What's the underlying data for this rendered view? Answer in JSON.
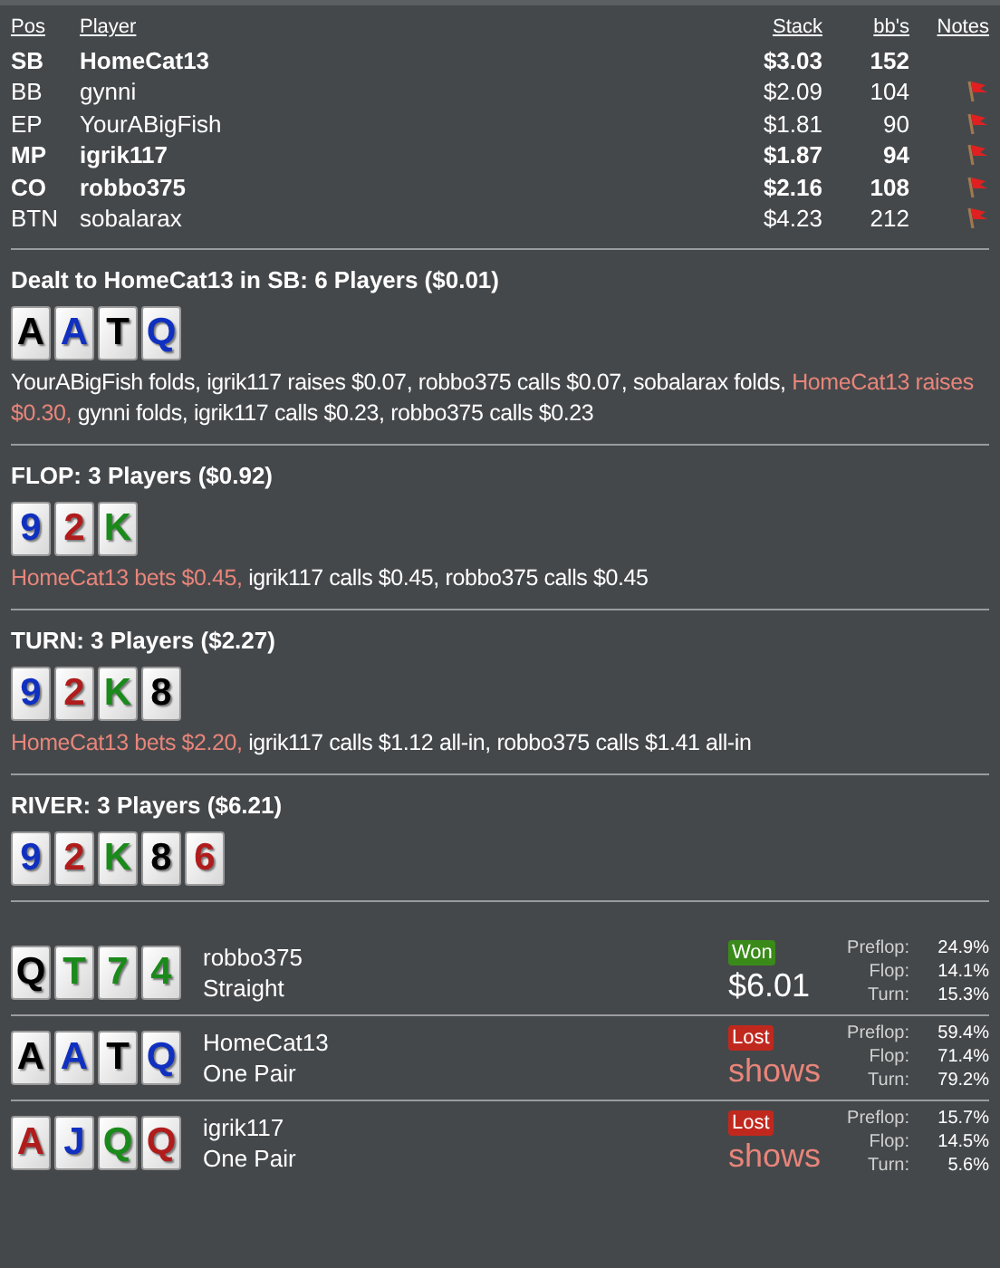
{
  "players_table": {
    "columns": [
      "Pos",
      "Player",
      "Stack",
      "bb's",
      "Notes"
    ],
    "rows": [
      {
        "pos": "SB",
        "player": "HomeCat13",
        "stack": "$3.03",
        "bbs": "152",
        "bold": true,
        "note": false
      },
      {
        "pos": "BB",
        "player": "gynni",
        "stack": "$2.09",
        "bbs": "104",
        "bold": false,
        "note": true
      },
      {
        "pos": "EP",
        "player": "YourABigFish",
        "stack": "$1.81",
        "bbs": "90",
        "bold": false,
        "note": true
      },
      {
        "pos": "MP",
        "player": "igrik117",
        "stack": "$1.87",
        "bbs": "94",
        "bold": true,
        "note": true
      },
      {
        "pos": "CO",
        "player": "robbo375",
        "stack": "$2.16",
        "bbs": "108",
        "bold": true,
        "note": true
      },
      {
        "pos": "BTN",
        "player": "sobalarax",
        "stack": "$4.23",
        "bbs": "212",
        "bold": false,
        "note": true
      }
    ]
  },
  "streets": [
    {
      "title": "Dealt to HomeCat13 in SB: 6 Players ($0.01)",
      "cards": [
        {
          "rank": "A",
          "color": "#000000"
        },
        {
          "rank": "A",
          "color": "#1030c0"
        },
        {
          "rank": "T",
          "color": "#000000"
        },
        {
          "rank": "Q",
          "color": "#1030c0"
        }
      ],
      "actions": [
        {
          "text": "YourABigFish folds, igrik117 raises $0.07, robbo375 calls $0.07, sobalarax folds, ",
          "hero": false
        },
        {
          "text": "HomeCat13 raises $0.30,",
          "hero": true
        },
        {
          "text": " gynni folds, igrik117 calls $0.23, robbo375 calls $0.23",
          "hero": false
        }
      ]
    },
    {
      "title": "FLOP: 3 Players ($0.92)",
      "cards": [
        {
          "rank": "9",
          "color": "#1030c0"
        },
        {
          "rank": "2",
          "color": "#b01c1c"
        },
        {
          "rank": "K",
          "color": "#1a8a1a"
        }
      ],
      "actions": [
        {
          "text": "HomeCat13 bets $0.45,",
          "hero": true
        },
        {
          "text": " igrik117 calls $0.45, robbo375 calls $0.45",
          "hero": false
        }
      ]
    },
    {
      "title": "TURN: 3 Players ($2.27)",
      "cards": [
        {
          "rank": "9",
          "color": "#1030c0"
        },
        {
          "rank": "2",
          "color": "#b01c1c"
        },
        {
          "rank": "K",
          "color": "#1a8a1a"
        },
        {
          "rank": "8",
          "color": "#000000"
        }
      ],
      "actions": [
        {
          "text": "HomeCat13 bets $2.20,",
          "hero": true
        },
        {
          "text": " igrik117 calls $1.12 all-in, robbo375 calls $1.41 all-in",
          "hero": false
        }
      ]
    },
    {
      "title": "RIVER: 3 Players ($6.21)",
      "cards": [
        {
          "rank": "9",
          "color": "#1030c0"
        },
        {
          "rank": "2",
          "color": "#b01c1c"
        },
        {
          "rank": "K",
          "color": "#1a8a1a"
        },
        {
          "rank": "8",
          "color": "#000000"
        },
        {
          "rank": "6",
          "color": "#b01c1c"
        }
      ]
    }
  ],
  "showdown": [
    {
      "cards": [
        {
          "rank": "Q",
          "color": "#000000"
        },
        {
          "rank": "T",
          "color": "#1a8a1a"
        },
        {
          "rank": "7",
          "color": "#1a8a1a"
        },
        {
          "rank": "4",
          "color": "#1a8a1a"
        }
      ],
      "player": "robbo375",
      "hand": "Straight",
      "result": "Won",
      "kind": "won",
      "amount": "$6.01",
      "equity": [
        {
          "label": "Preflop:",
          "value": "24.9%"
        },
        {
          "label": "Flop:",
          "value": "14.1%"
        },
        {
          "label": "Turn:",
          "value": "15.3%"
        }
      ]
    },
    {
      "cards": [
        {
          "rank": "A",
          "color": "#000000"
        },
        {
          "rank": "A",
          "color": "#1030c0"
        },
        {
          "rank": "T",
          "color": "#000000"
        },
        {
          "rank": "Q",
          "color": "#1030c0"
        }
      ],
      "player": "HomeCat13",
      "hand": "One Pair",
      "result": "Lost",
      "kind": "lost",
      "amount": "shows",
      "equity": [
        {
          "label": "Preflop:",
          "value": "59.4%"
        },
        {
          "label": "Flop:",
          "value": "71.4%"
        },
        {
          "label": "Turn:",
          "value": "79.2%"
        }
      ]
    },
    {
      "cards": [
        {
          "rank": "A",
          "color": "#b01c1c"
        },
        {
          "rank": "J",
          "color": "#1030c0"
        },
        {
          "rank": "Q",
          "color": "#1a8a1a"
        },
        {
          "rank": "Q",
          "color": "#b01c1c"
        }
      ],
      "player": "igrik117",
      "hand": "One Pair",
      "result": "Lost",
      "kind": "lost",
      "amount": "shows",
      "equity": [
        {
          "label": "Preflop:",
          "value": "15.7%"
        },
        {
          "label": "Flop:",
          "value": "14.5%"
        },
        {
          "label": "Turn:",
          "value": "5.6%"
        }
      ]
    }
  ]
}
